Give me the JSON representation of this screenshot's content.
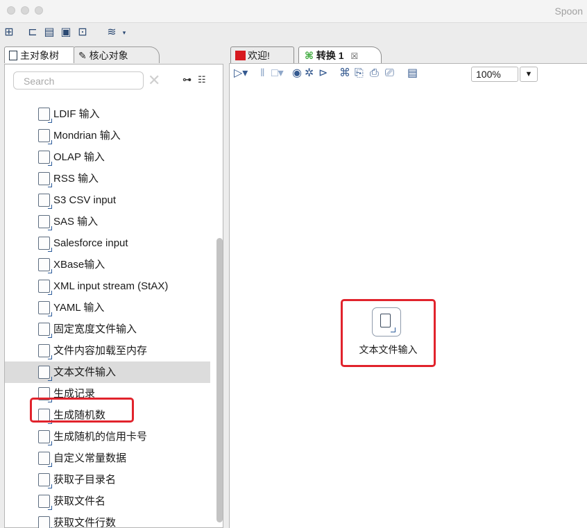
{
  "window": {
    "title": "Spoon"
  },
  "left_panel": {
    "tabs": [
      "主对象树",
      "核心对象"
    ],
    "search_placeholder": "Search",
    "items": [
      {
        "label": "LDIF 输入",
        "icon": "ldif-icon"
      },
      {
        "label": "Mondrian 输入",
        "icon": "mondrian-icon"
      },
      {
        "label": "OLAP 输入",
        "icon": "olap-icon"
      },
      {
        "label": "RSS 输入",
        "icon": "rss-icon"
      },
      {
        "label": "S3 CSV input",
        "icon": "s3-csv-icon"
      },
      {
        "label": "SAS 输入",
        "icon": "sas-icon"
      },
      {
        "label": "Salesforce input",
        "icon": "salesforce-icon"
      },
      {
        "label": "XBase输入",
        "icon": "xbase-icon"
      },
      {
        "label": "XML input stream (StAX)",
        "icon": "xml-stream-icon"
      },
      {
        "label": "YAML 输入",
        "icon": "yaml-icon"
      },
      {
        "label": "固定宽度文件输入",
        "icon": "fixed-width-file-icon"
      },
      {
        "label": "文件内容加载至内存",
        "icon": "load-file-icon"
      },
      {
        "label": "文本文件输入",
        "icon": "text-file-input-icon",
        "selected": true
      },
      {
        "label": "生成记录",
        "icon": "generate-rows-icon"
      },
      {
        "label": "生成随机数",
        "icon": "random-value-icon"
      },
      {
        "label": "生成随机的信用卡号",
        "icon": "random-card-icon"
      },
      {
        "label": "自定义常量数据",
        "icon": "data-grid-icon"
      },
      {
        "label": "获取子目录名",
        "icon": "subfolder-icon"
      },
      {
        "label": "获取文件名",
        "icon": "filename-icon"
      },
      {
        "label": "获取文件行数",
        "icon": "file-rows-icon"
      }
    ]
  },
  "right_panel": {
    "tabs": [
      {
        "label": "欢迎!",
        "icon": "welcome-icon"
      },
      {
        "label": "转换 1",
        "icon": "transformation-icon",
        "active": true
      }
    ],
    "close_glyph": "☒",
    "zoom": "100%",
    "canvas_step": {
      "label": "文本文件输入",
      "icon": "text-file-input-icon"
    }
  }
}
